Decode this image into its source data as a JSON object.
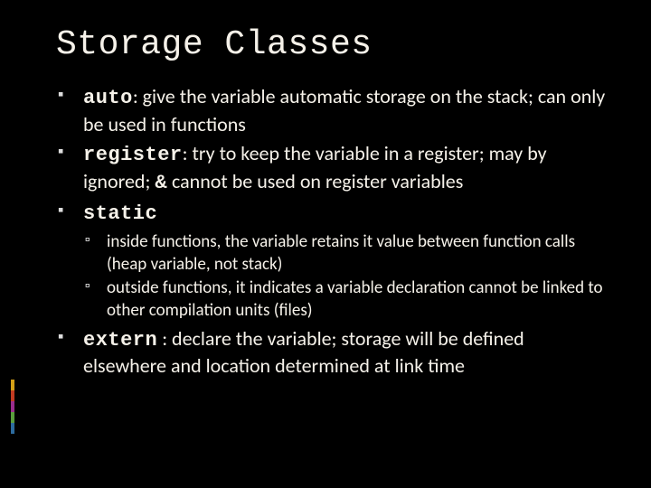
{
  "title": "Storage Classes",
  "bullets": [
    {
      "code": "auto",
      "text": ": give the variable automatic storage on the stack; can only be used in functions"
    },
    {
      "code": "register",
      "text_before": ": try to keep the variable in a register; may by ignored; ",
      "inline_code": "&",
      "text_after": " cannot be used on register variables"
    },
    {
      "code": "static",
      "text": "",
      "sub": [
        "inside functions, the variable retains it value between function calls (heap variable, not stack)",
        "outside functions, it indicates a variable declaration cannot be linked to other compilation units (files)"
      ]
    },
    {
      "code": "extern",
      "text": " : declare the variable; storage will be defined elsewhere and location determined at link time"
    }
  ],
  "accent_colors": [
    "#d4a017",
    "#c23b22",
    "#9b2d8e",
    "#5a9e3d",
    "#2d6b9e"
  ]
}
